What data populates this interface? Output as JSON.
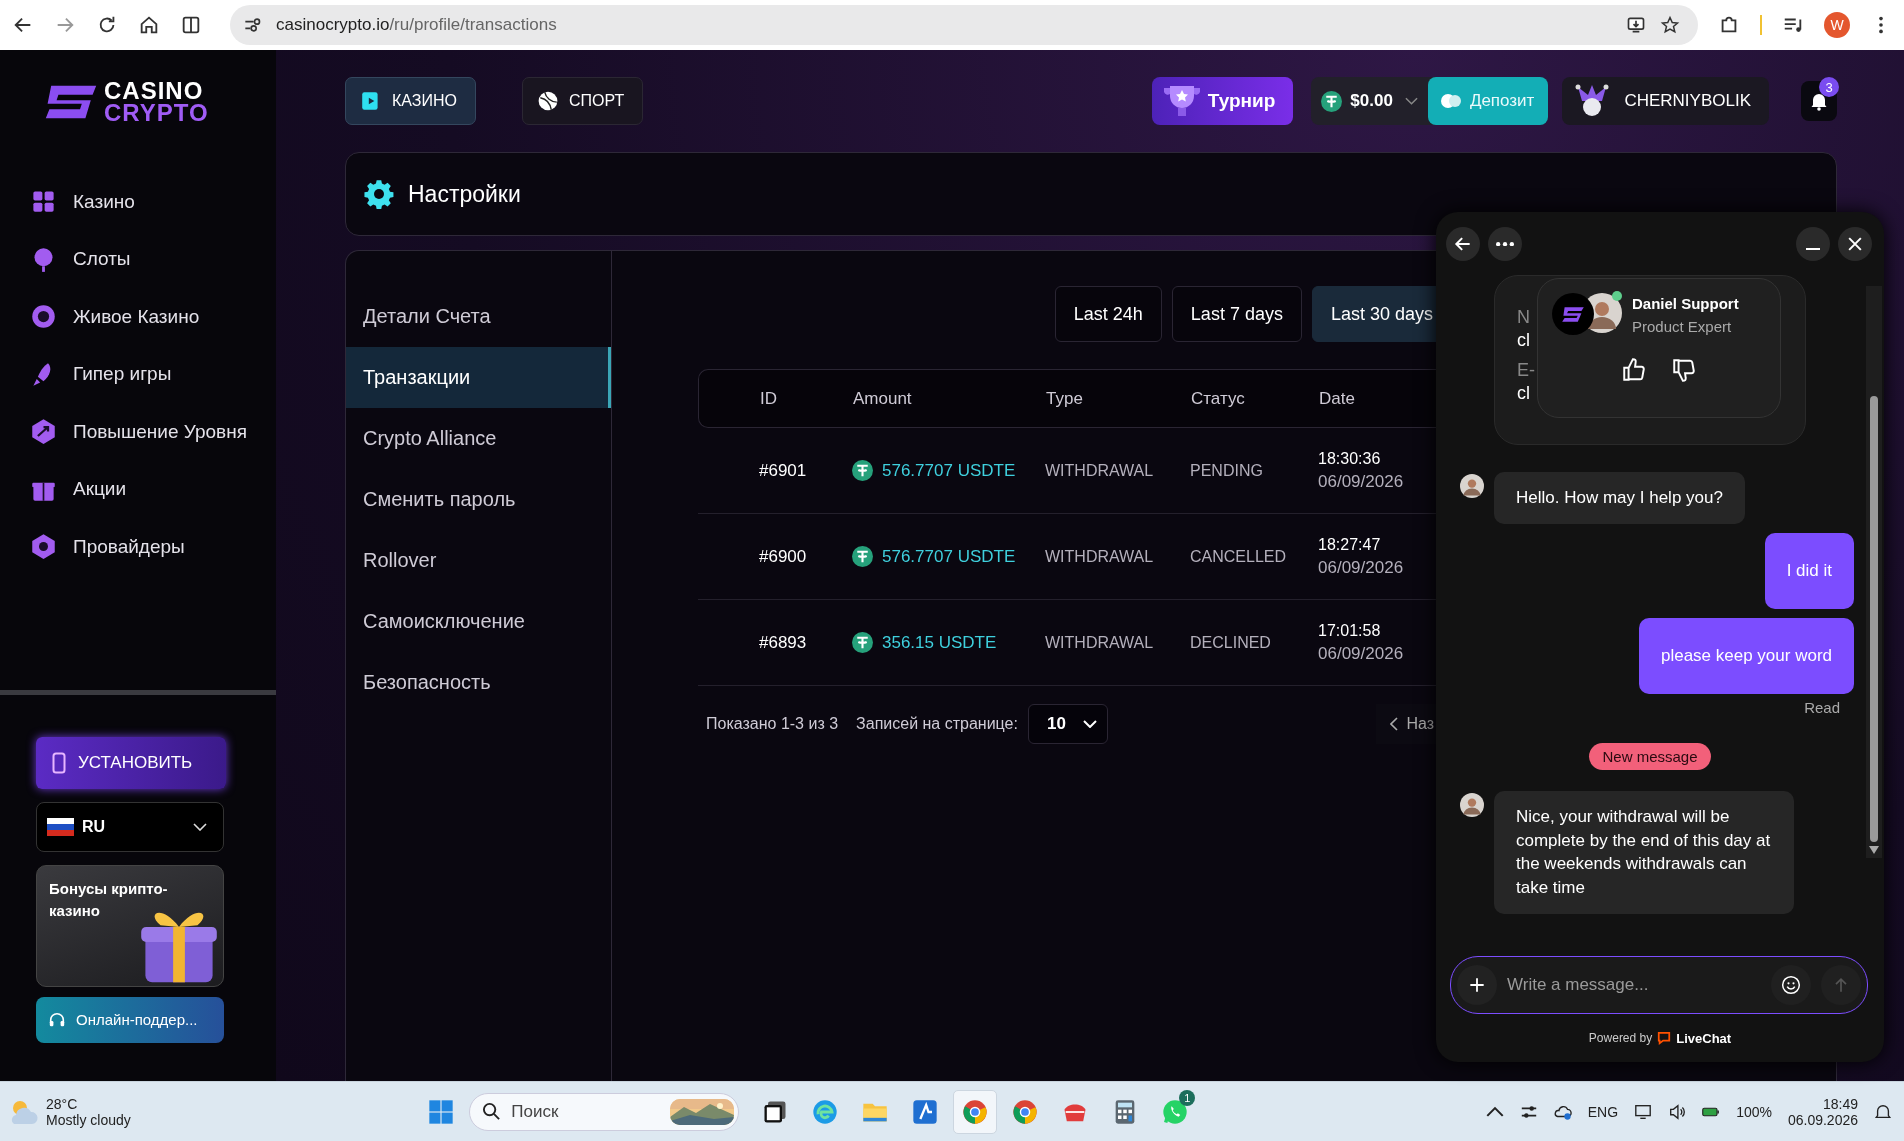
{
  "browser": {
    "url_domain": "casinocrypto.io",
    "url_path": "/ru/profile/transactions",
    "profile_initial": "W"
  },
  "sidebar": {
    "logo_top": "CASINO",
    "logo_bottom": "CRYPTO",
    "items": [
      {
        "label": "Казино",
        "selected": false
      },
      {
        "label": "Слоты",
        "selected": false
      },
      {
        "label": "Живое Казино",
        "selected": false
      },
      {
        "label": "Гипер игры",
        "selected": false
      },
      {
        "label": "Повышение Уровня",
        "selected": false
      },
      {
        "label": "Акции",
        "selected": false
      },
      {
        "label": "Провайдеры",
        "selected": false
      }
    ],
    "install_button": "УСТАНОВИТЬ",
    "language": "RU",
    "promo": "Бонусы крипто-казино",
    "support_button": "Онлайн-поддер..."
  },
  "topbar": {
    "tabs": [
      {
        "label": "КАЗИНО",
        "selected": true
      },
      {
        "label": "СПОРТ",
        "selected": false
      }
    ],
    "tournament": "Турнир",
    "balance": "$0.00",
    "deposit": "Депозит",
    "username": "CHERNIYBOLIK",
    "notifications": "3"
  },
  "page": {
    "title": "Настройки",
    "menu": [
      {
        "label": "Детали Счета",
        "selected": false
      },
      {
        "label": "Транзакции",
        "selected": true
      },
      {
        "label": "Crypto Alliance",
        "selected": false
      },
      {
        "label": "Сменить пароль",
        "selected": false
      },
      {
        "label": "Rollover",
        "selected": false
      },
      {
        "label": "Самоисключение",
        "selected": false
      },
      {
        "label": "Безопасность",
        "selected": false
      }
    ],
    "filters": [
      {
        "label": "Last 24h",
        "selected": false
      },
      {
        "label": "Last 7 days",
        "selected": false
      },
      {
        "label": "Last 30 days",
        "selected": true
      }
    ],
    "table": {
      "columns": [
        "ID",
        "Amount",
        "Type",
        "Статус",
        "Date"
      ],
      "rows": [
        {
          "id": "#6901",
          "amount": "576.7707 USDTE",
          "type": "WITHDRAWAL",
          "status": "PENDING",
          "time": "18:30:36",
          "date": "06/09/2026"
        },
        {
          "id": "#6900",
          "amount": "576.7707 USDTE",
          "type": "WITHDRAWAL",
          "status": "CANCELLED",
          "time": "18:27:47",
          "date": "06/09/2026"
        },
        {
          "id": "#6893",
          "amount": "356.15 USDTE",
          "type": "WITHDRAWAL",
          "status": "DECLINED",
          "time": "17:01:58",
          "date": "06/09/2026"
        }
      ]
    },
    "pagination": {
      "summary": "Показано 1-3 из 3",
      "per_page_label": "Записей на странице:",
      "per_page": "10",
      "prev": "Наз"
    }
  },
  "chat": {
    "form_fragments": [
      "N",
      "cl",
      "E-",
      "cl"
    ],
    "agent": {
      "name": "Daniel Support",
      "role": "Product Expert",
      "online": true
    },
    "messages": [
      {
        "kind": "agent",
        "text": "Hello. How may I help you?"
      },
      {
        "kind": "user",
        "text": "I did it"
      },
      {
        "kind": "user",
        "text": "please keep your word"
      },
      {
        "kind": "receipt",
        "text": "Read"
      },
      {
        "kind": "divider",
        "text": "New message"
      },
      {
        "kind": "agent",
        "text": "Nice, your withdrawal will be complete by the end of this day at the weekends withdrawals can take time"
      }
    ],
    "input_placeholder": "Write a message...",
    "powered_by": "Powered by",
    "brand": "LiveChat"
  },
  "taskbar": {
    "temperature": "28°C",
    "condition": "Mostly cloudy",
    "search_placeholder": "Поиск",
    "chat_app_badge": "1",
    "language": "ENG",
    "battery": "100%",
    "time": "18:49",
    "date": "06.09.2026"
  }
}
